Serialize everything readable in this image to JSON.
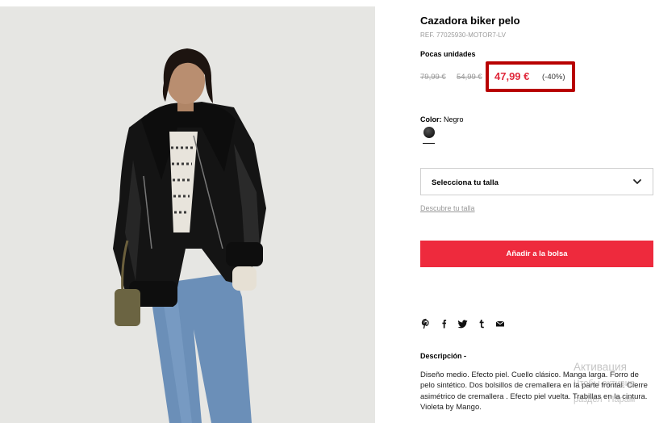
{
  "product": {
    "title": "Cazadora biker pelo",
    "ref": "REF. 77025930-MOTOR7-LV",
    "stock_label": "Pocas unidades"
  },
  "pricing": {
    "original_price": "79,99 €",
    "previous_price": "54,99 €",
    "current_price": "47,99 €",
    "discount": "(-40%)"
  },
  "color": {
    "label": "Color:",
    "value": "Negro",
    "swatch_hex": "#222222"
  },
  "size": {
    "select_label": "Selecciona tu talla",
    "guide_link": "Descubre tu talla"
  },
  "actions": {
    "add_to_bag": "Añadir a la bolsa"
  },
  "share_icons": [
    "pinterest-icon",
    "facebook-icon",
    "twitter-icon",
    "tumblr-icon",
    "email-icon"
  ],
  "description": {
    "title": "Descripción -",
    "text": "Diseño medio. Efecto piel. Cuello clásico. Manga larga. Forro de pelo sintético. Dos bolsillos de cremallera en la parte frontal. Cierre asimétrico de cremallera . Efecto piel vuelta. Trabillas en la cintura. Violeta by Mango."
  },
  "os_watermark": {
    "line1": "Активация",
    "line2": "Чтобы активир",
    "line3": "раздел \"Парам"
  },
  "colors": {
    "accent_red": "#ee2a3d",
    "price_red": "#e0293c",
    "highlight_border": "#b80000"
  }
}
